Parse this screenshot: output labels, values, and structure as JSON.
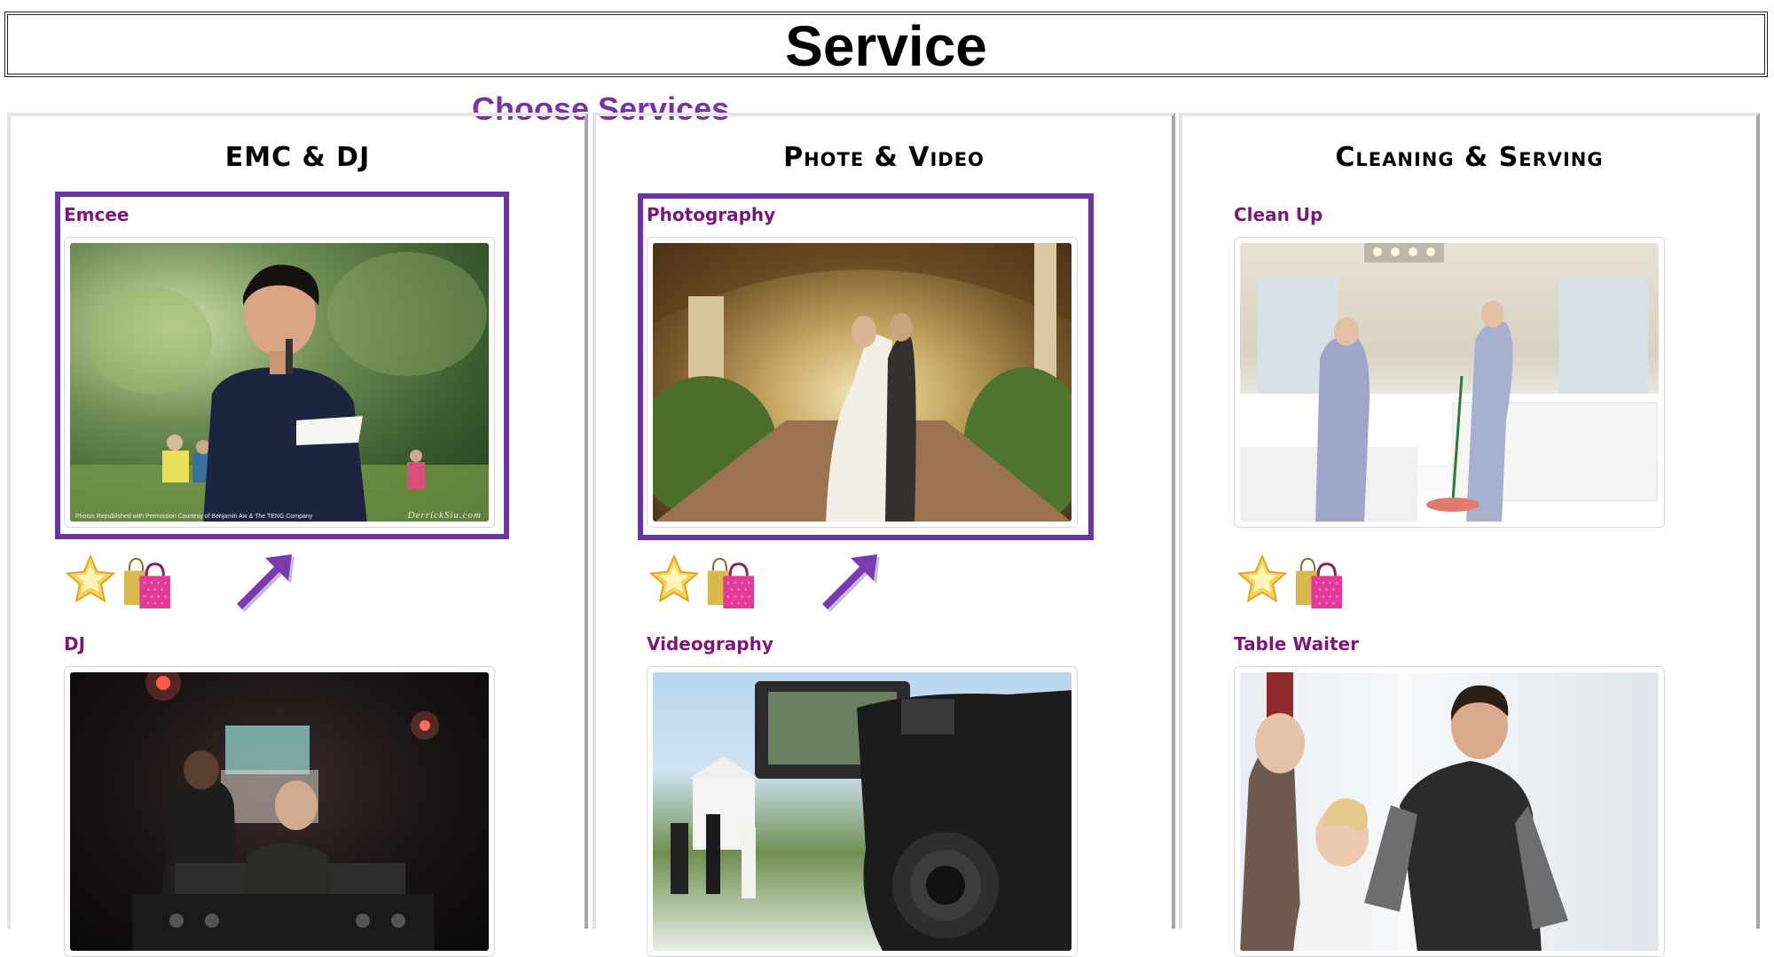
{
  "page": {
    "title": "Service",
    "subtitle": "Choose Services"
  },
  "columns": [
    {
      "heading": "EMC & DJ",
      "services": [
        {
          "label": "Emcee",
          "selected": true,
          "photo": "emcee-photo",
          "photo_caption_left": "Photos Republished with Permission Courtesy of Benjamin Aw & The TENG Company",
          "photo_caption_right": "DerrickSiu.com"
        },
        {
          "label": "DJ",
          "selected": false,
          "photo": "dj-photo"
        }
      ]
    },
    {
      "heading": "Phote & Video",
      "services": [
        {
          "label": "Photography",
          "selected": true,
          "photo": "wedding-couple-photo"
        },
        {
          "label": "Videography",
          "selected": false,
          "photo": "camcorder-photo"
        }
      ]
    },
    {
      "heading": "Cleaning & Serving",
      "services": [
        {
          "label": "Clean Up",
          "selected": false,
          "photo": "cleaning-staff-photo"
        },
        {
          "label": "Table Waiter",
          "selected": false,
          "photo": "waiter-photo"
        }
      ]
    }
  ],
  "icons": {
    "favorite": "star-icon",
    "add_to_cart": "shopping-bag-icon",
    "pointer": "arrow-up-right-icon"
  },
  "colors": {
    "accent": "#6b35a8",
    "label": "#7a177a",
    "subtitle": "#7634a6"
  }
}
